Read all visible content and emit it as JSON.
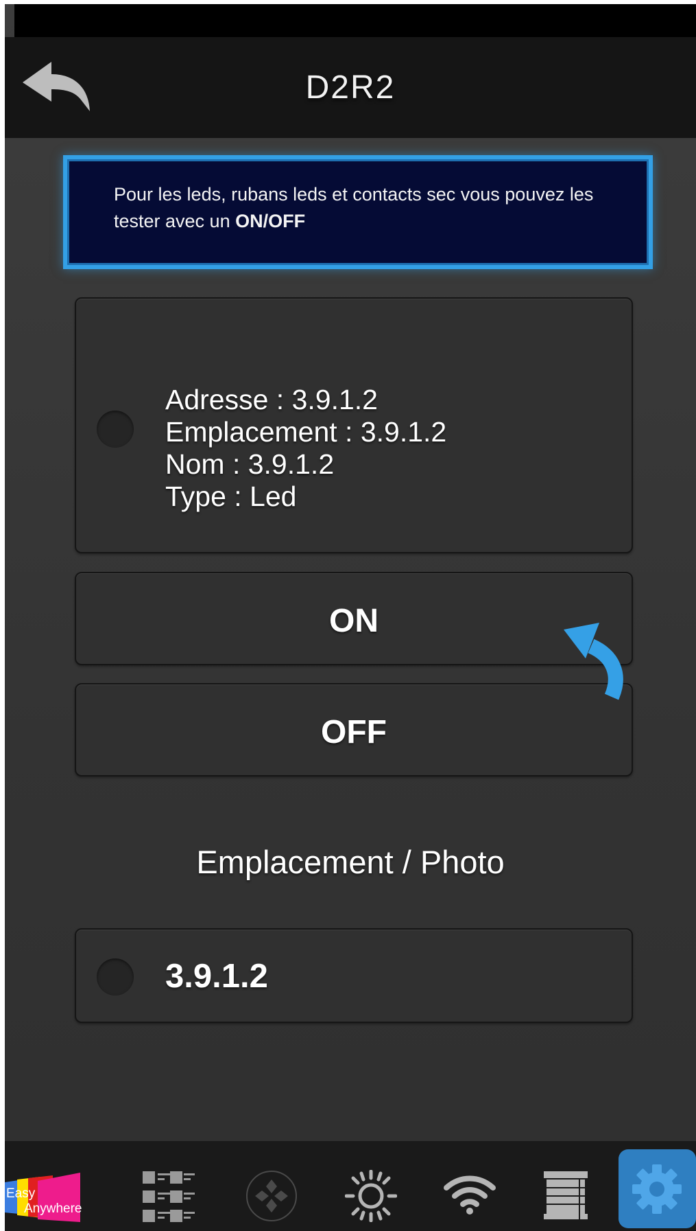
{
  "header": {
    "title": "D2R2",
    "back_icon": "back-arrow-icon"
  },
  "info_banner": {
    "text": "Pour les leds, rubans leds et contacts sec vous pouvez les tester avec un ",
    "highlight": "ON/OFF"
  },
  "device": {
    "address": "Adresse : 3.9.1.2",
    "location": "Emplacement : 3.9.1.2",
    "name": "Nom : 3.9.1.2",
    "type": "Type : Led"
  },
  "buttons": {
    "on": "ON",
    "off": "OFF"
  },
  "section": {
    "title": "Emplacement / Photo"
  },
  "photo_item": {
    "label": "3.9.1.2"
  },
  "tabbar": {
    "items": [
      {
        "icon": "easy-anywhere-logo",
        "logo_text_1": "Easy",
        "logo_text_2": "Anywhere"
      },
      {
        "icon": "scenes-grid-icon"
      },
      {
        "icon": "remote-dpad-icon"
      },
      {
        "icon": "light-sun-icon"
      },
      {
        "icon": "wifi-icon"
      },
      {
        "icon": "blinds-icon"
      },
      {
        "icon": "settings-gear-icon",
        "active": true
      }
    ]
  },
  "colors": {
    "accent": "#33a0e6",
    "banner_bg": "#050b35",
    "active_tab": "#2f7fc1"
  }
}
